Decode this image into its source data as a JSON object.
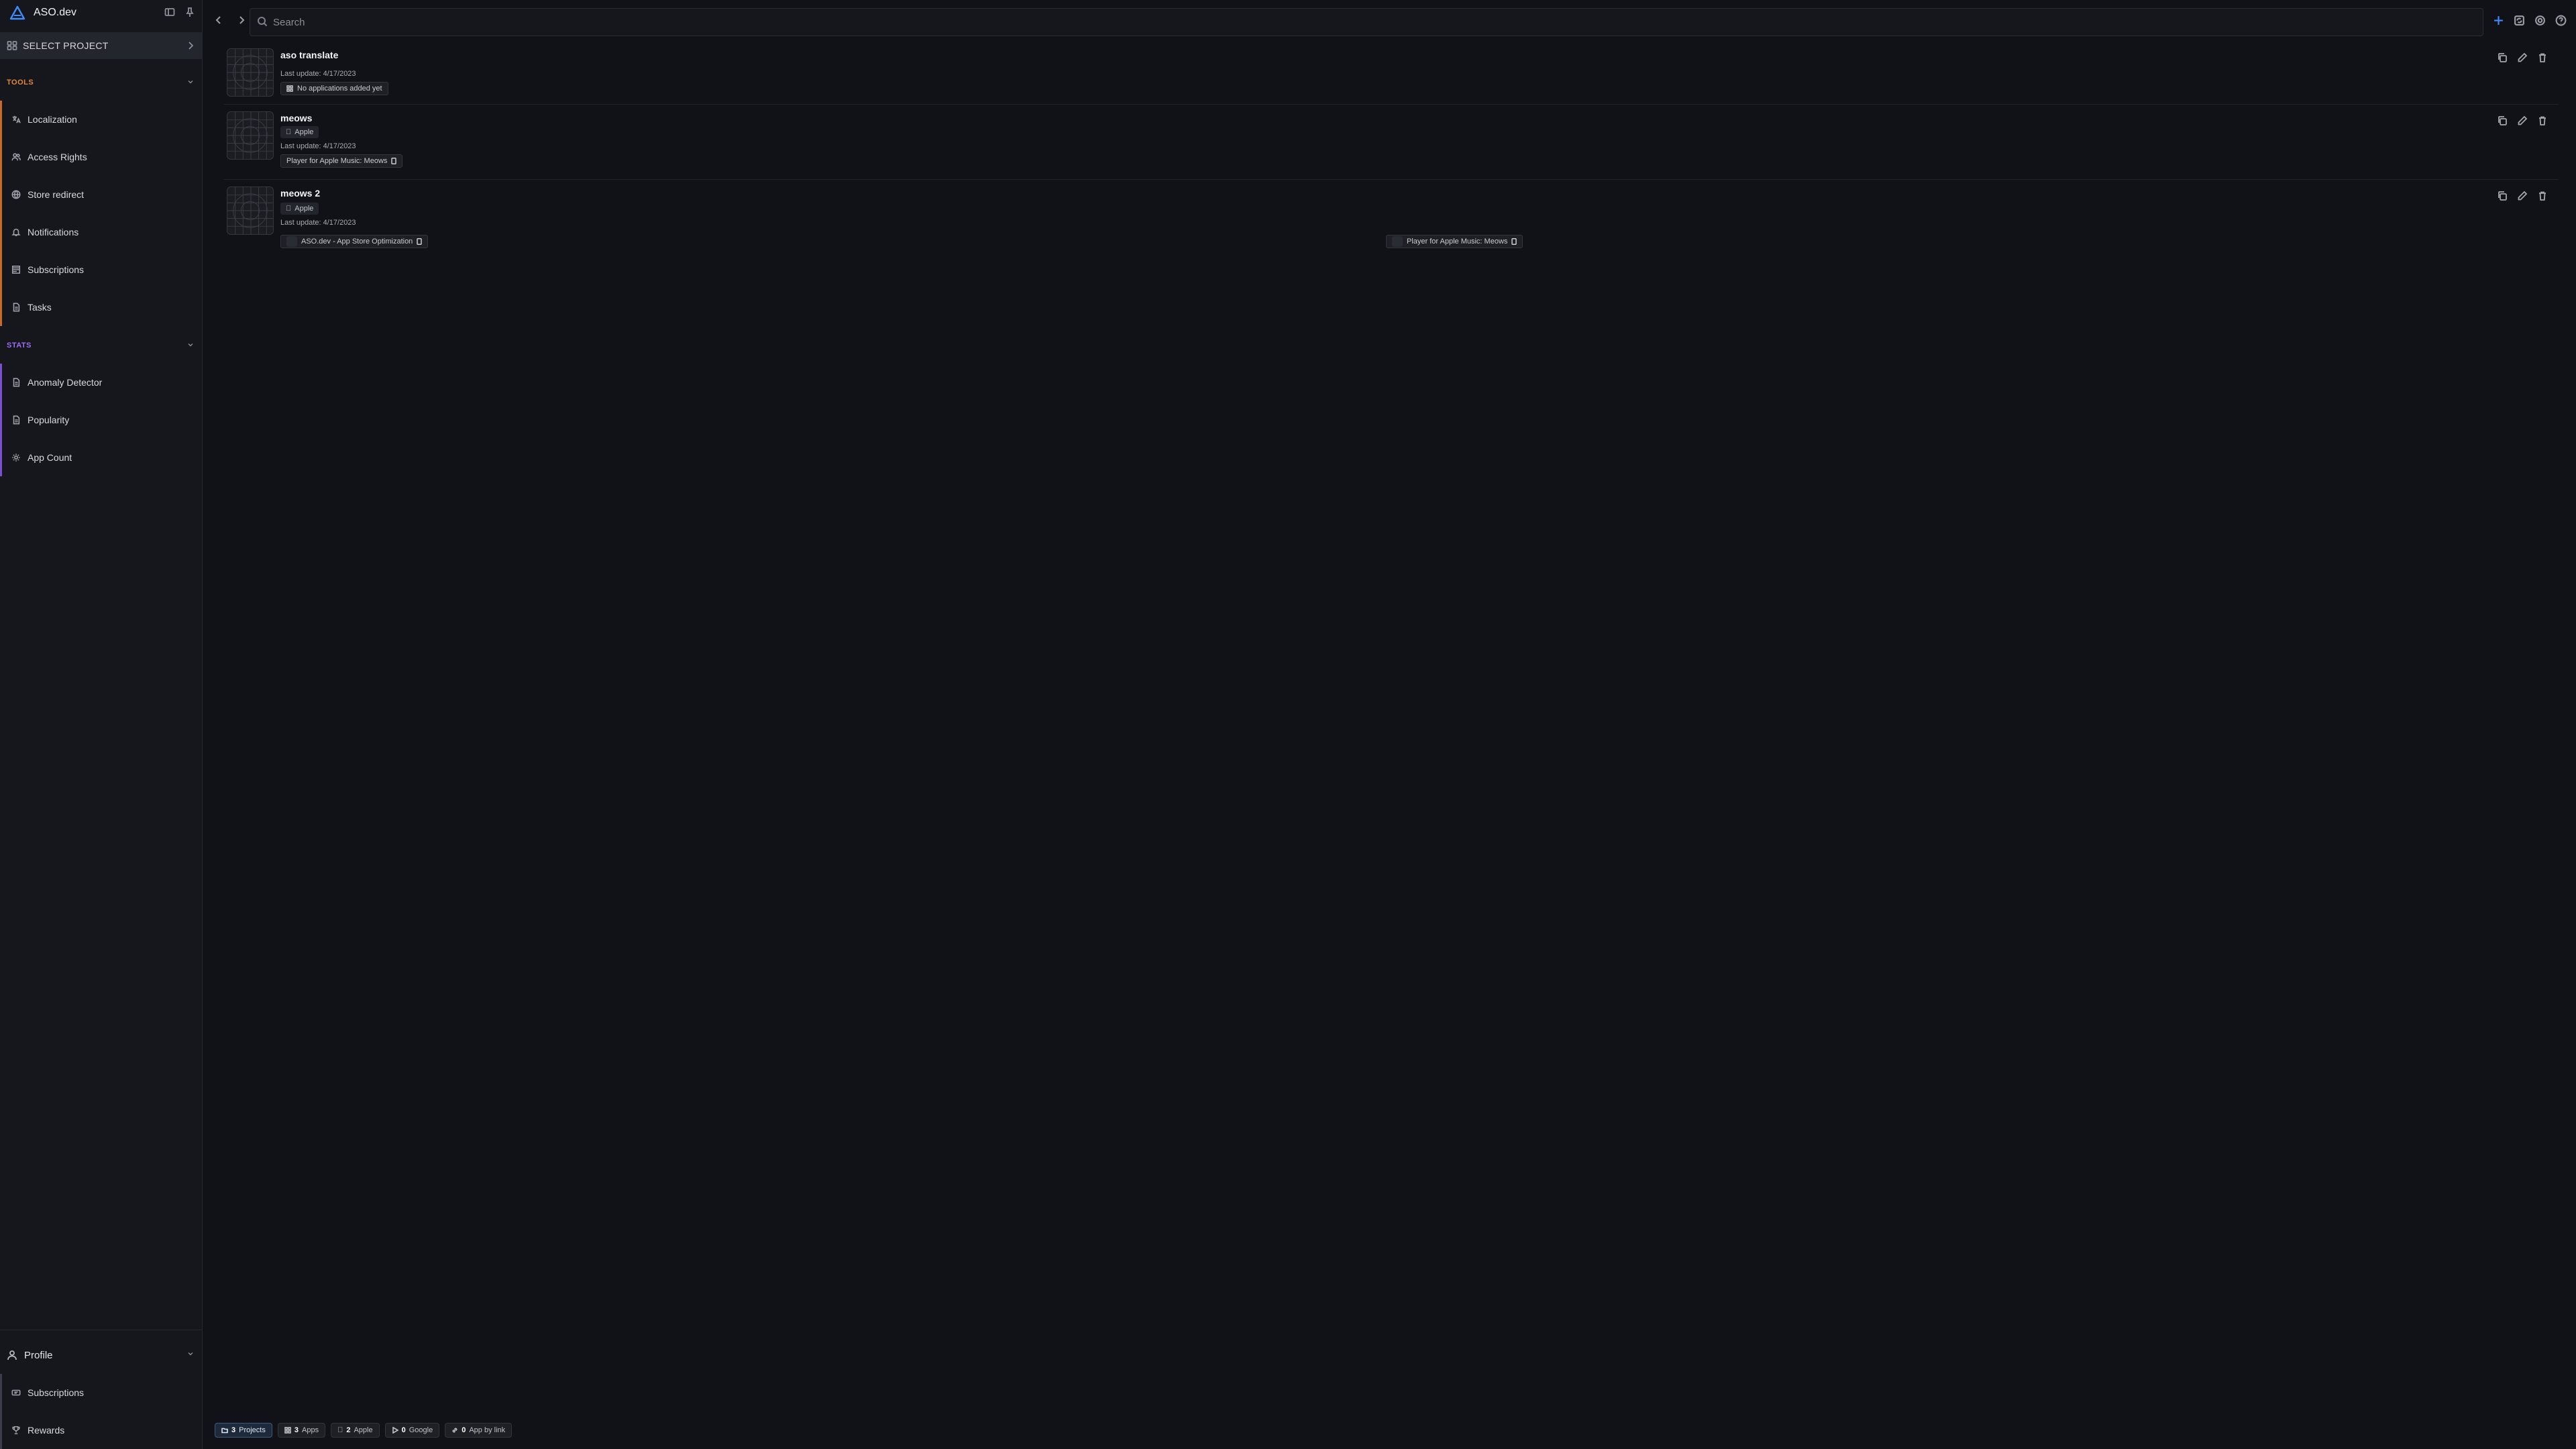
{
  "brand": {
    "name": "ASO.dev",
    "logo_color": "#3f8cff"
  },
  "sidebar": {
    "select_project_label": "SELECT PROJECT",
    "tools_header": "TOOLS",
    "tools_color": "#e0883d",
    "tools": [
      {
        "label": "Localization",
        "icon": "translate-icon"
      },
      {
        "label": "Access Rights",
        "icon": "users-icon"
      },
      {
        "label": "Store redirect",
        "icon": "globe-icon"
      },
      {
        "label": "Notifications",
        "icon": "bell-icon"
      },
      {
        "label": "Subscriptions",
        "icon": "subscriptions-icon"
      },
      {
        "label": "Tasks",
        "icon": "tasks-icon"
      }
    ],
    "stats_header": "STATS",
    "stats_color": "#9b6ef3",
    "stats": [
      {
        "label": "Anomaly Detector",
        "icon": "doc-icon"
      },
      {
        "label": "Popularity",
        "icon": "doc-icon"
      },
      {
        "label": "App Count",
        "icon": "gear-icon"
      }
    ],
    "profile_label": "Profile",
    "profile_items": [
      {
        "label": "Subscriptions",
        "icon": "ticket-icon"
      },
      {
        "label": "Rewards",
        "icon": "trophy-icon"
      }
    ]
  },
  "search": {
    "placeholder": "Search",
    "value": ""
  },
  "projects": [
    {
      "name": "aso translate",
      "last_update": "Last update: 4/17/2023",
      "chips": [
        "No applications added yet"
      ]
    },
    {
      "name": "meows",
      "store": "Apple",
      "last_update": "Last update: 4/17/2023",
      "chips": [
        "Player for Apple Music: Meows"
      ]
    },
    {
      "name": "meows 2",
      "store": "Apple",
      "last_update": "Last update: 4/17/2023",
      "chips": [
        "ASO.dev - App Store Optimization",
        "Player for Apple Music: Meows"
      ]
    }
  ],
  "footer": {
    "projects": {
      "count": "3",
      "label": "Projects"
    },
    "apps": {
      "count": "3",
      "label": "Apps"
    },
    "apple": {
      "count": "2",
      "label": "Apple"
    },
    "google": {
      "count": "0",
      "label": "Google"
    },
    "app_by_link": {
      "count": "0",
      "label": "App by link"
    }
  },
  "accent_blue": "#3f8cff"
}
